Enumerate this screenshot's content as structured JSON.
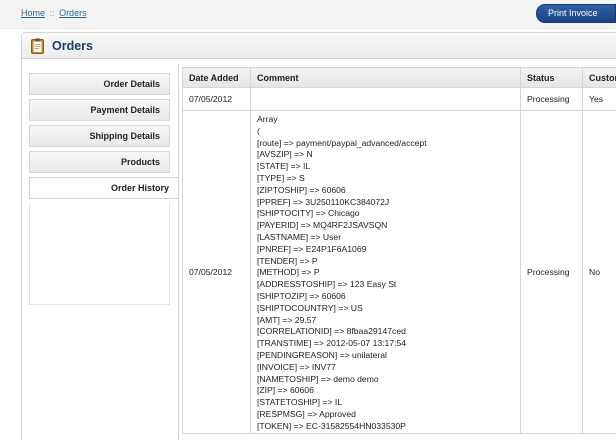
{
  "breadcrumb": {
    "home": "Home",
    "separator": "::",
    "current": "Orders"
  },
  "panel": {
    "title": "Orders",
    "print_button": "Print Invoice"
  },
  "tabs": [
    {
      "label": "Order Details"
    },
    {
      "label": "Payment Details"
    },
    {
      "label": "Shipping Details"
    },
    {
      "label": "Products"
    },
    {
      "label": "Order History"
    }
  ],
  "table": {
    "headers": {
      "date": "Date Added",
      "comment": "Comment",
      "status": "Status",
      "customer": "Customer Notified"
    },
    "rows": [
      {
        "date": "07/05/2012",
        "comment": "",
        "status": "Processing",
        "notified": "Yes"
      },
      {
        "date": "07/05/2012",
        "comment_lines": [
          "Array",
          "(",
          "[route] => payment/paypal_advanced/accept",
          "[AVSZIP] => N",
          "[STATE] => IL",
          "[TYPE] => S",
          "[ZIPTOSHIP] => 60606",
          "[PPREF] => 3U250110KC384072J",
          "[SHIPTOCITY] => Chicago",
          "[PAYERID] => MQ4RF2JSAVSQN",
          "[LASTNAME] => User",
          "[PNREF] => E24P1F6A1069",
          "[TENDER] => P",
          "[METHOD] => P",
          "[ADDRESSTOSHIP] => 123 Easy St",
          "[SHIPTOZIP] => 60606",
          "[SHIPTOCOUNTRY] => US",
          "[AMT] => 29.57",
          "[CORRELATIONID] => 8fbaa29147ced",
          "[TRANSTIME] => 2012-05-07 13:17:54",
          "[PENDINGREASON] => unilateral",
          "[INVOICE] => INV77",
          "[NAMETOSHIP] => demo demo",
          "[ZIP] => 60606",
          "[STATETOSHIP] => IL",
          "[RESPMSG] => Approved",
          "[TOKEN] => EC-31582554HN033530P"
        ],
        "status": "Processing",
        "notified": "No"
      }
    ]
  }
}
